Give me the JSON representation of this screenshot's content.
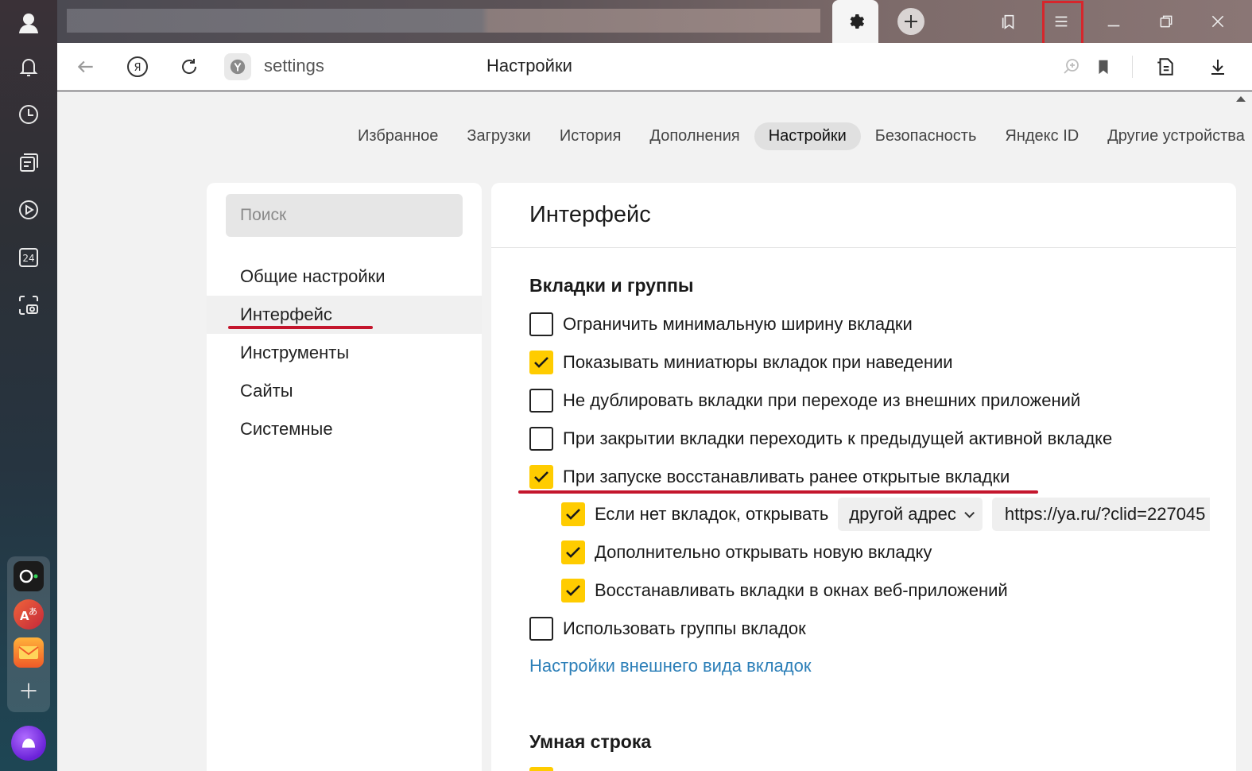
{
  "address_bar": {
    "url": "settings",
    "page_title": "Настройки"
  },
  "top_tabs": [
    {
      "label": "Избранное",
      "active": false
    },
    {
      "label": "Загрузки",
      "active": false
    },
    {
      "label": "История",
      "active": false
    },
    {
      "label": "Дополнения",
      "active": false
    },
    {
      "label": "Настройки",
      "active": true
    },
    {
      "label": "Безопасность",
      "active": false
    },
    {
      "label": "Яндекс ID",
      "active": false
    },
    {
      "label": "Другие устройства",
      "active": false
    }
  ],
  "sidebar_nav": {
    "search_placeholder": "Поиск",
    "items": [
      {
        "label": "Общие настройки"
      },
      {
        "label": "Интерфейс",
        "active": true
      },
      {
        "label": "Инструменты"
      },
      {
        "label": "Сайты"
      },
      {
        "label": "Системные"
      }
    ]
  },
  "sidebar_badge_24": "24",
  "panel": {
    "title": "Интерфейс",
    "section_tabs_title": "Вкладки и группы",
    "options": [
      {
        "label": "Ограничить минимальную ширину вкладки",
        "checked": false
      },
      {
        "label": "Показывать миниатюры вкладок при наведении",
        "checked": true
      },
      {
        "label": "Не дублировать вкладки при переходе из внешних приложений",
        "checked": false
      },
      {
        "label": "При закрытии вкладки переходить к предыдущей активной вкладке",
        "checked": false
      },
      {
        "label": "При запуске восстанавливать ранее открытые вкладки",
        "checked": true
      },
      {
        "label": "Если нет вкладок, открывать",
        "checked": true
      },
      {
        "label": "Дополнительно открывать новую вкладку",
        "checked": true
      },
      {
        "label": "Восстанавливать вкладки в окнах веб-приложений",
        "checked": true
      },
      {
        "label": "Использовать группы вкладок",
        "checked": false
      }
    ],
    "open_select_value": "другой адрес",
    "open_url_value": "https://ya.ru/?clid=227045",
    "appearance_link": "Настройки внешнего вида вкладок",
    "section_smartline_title": "Умная строка"
  },
  "colors": {
    "checkbox_on": "#ffcc00",
    "annotation_red": "#c4162d",
    "link": "#2c7fb8"
  }
}
